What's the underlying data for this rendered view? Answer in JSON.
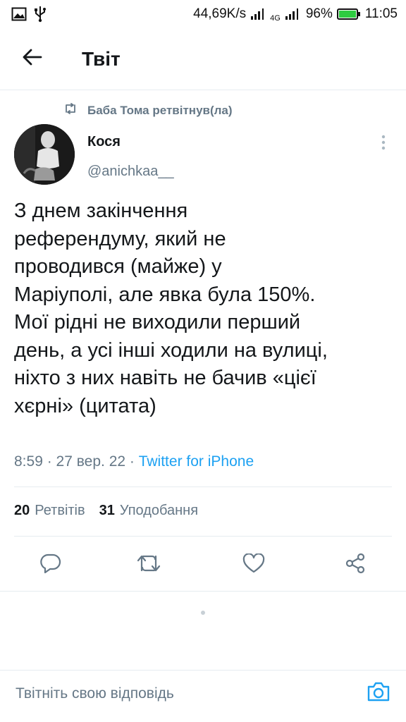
{
  "status_bar": {
    "speed": "44,69K/s",
    "network_label": "4G",
    "battery_percent": "96%",
    "time": "11:05",
    "icons": [
      "image-icon",
      "usb-icon",
      "signal-icon",
      "battery-icon"
    ]
  },
  "header": {
    "title": "Твіт",
    "back_icon": "arrow-left-icon"
  },
  "tweet": {
    "retweeted_by": "Баба Тома ретвітнув(ла)",
    "author_name": "Кося",
    "author_handle": "@anichkaa__",
    "text": "З днем закінчення\nреферендуму, який не\nпроводився (майже) у\nМаріуполі, але явка була 150%.\nМої рідні не виходили перший\nдень, а усі інші ходили на вулиці,\nніхто з них навіть не бачив «цієї\nхєрні» (цитата)",
    "time": "8:59",
    "date": "27 вер. 22",
    "source": "Twitter for iPhone",
    "separator": " · "
  },
  "stats": {
    "retweets_count": "20",
    "retweets_label": "Ретвітів",
    "likes_count": "31",
    "likes_label": "Уподобання"
  },
  "actions": [
    "reply-icon",
    "retweet-icon",
    "like-icon",
    "share-icon"
  ],
  "reply": {
    "placeholder": "Твітніть свою відповідь"
  },
  "colors": {
    "accent": "#1da1f2",
    "secondary_text": "#657786",
    "primary_text": "#14171a",
    "divider": "#e6ecf0",
    "battery": "#2ecc40"
  }
}
